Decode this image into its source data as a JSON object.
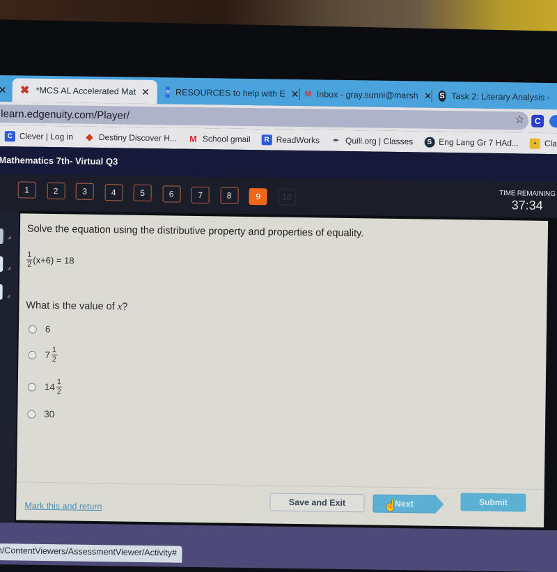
{
  "browser": {
    "tabs": [
      {
        "label": "*MCS AL Accelerated Mat",
        "icon": "edgenuity-x-icon",
        "active": true
      },
      {
        "label": "RESOURCES to help with E",
        "icon": "google-docs-icon",
        "active": false
      },
      {
        "label": "Inbox - gray.sunni@marsh",
        "icon": "gmail-icon",
        "active": false
      },
      {
        "label": "Task 2: Literary Analysis -",
        "icon": "schoology-icon",
        "active": false
      }
    ],
    "close_glyph": "✕",
    "url": "learn.edgenuity.com/Player/",
    "star_glyph": "☆",
    "bookmarks": [
      {
        "label": "Clever | Log in",
        "icon": "clever-icon"
      },
      {
        "label": "Destiny Discover H...",
        "icon": "destiny-icon"
      },
      {
        "label": "School gmail",
        "icon": "gmail-icon"
      },
      {
        "label": "ReadWorks",
        "icon": "readworks-icon"
      },
      {
        "label": "Quill.org | Classes",
        "icon": "quill-icon"
      },
      {
        "label": "Eng Lang Gr 7 HAd...",
        "icon": "schoology-icon"
      },
      {
        "label": "Class",
        "icon": "google-classroom-icon"
      }
    ],
    "status_url": "m/ContentViewers/AssessmentViewer/Activity#"
  },
  "app": {
    "course_title": "Mathematics 7th- Virtual Q3",
    "questions": [
      {
        "num": "1",
        "state": "answered"
      },
      {
        "num": "2",
        "state": "answered"
      },
      {
        "num": "3",
        "state": "answered"
      },
      {
        "num": "4",
        "state": "answered"
      },
      {
        "num": "5",
        "state": "answered"
      },
      {
        "num": "6",
        "state": "answered"
      },
      {
        "num": "7",
        "state": "answered"
      },
      {
        "num": "8",
        "state": "answered"
      },
      {
        "num": "9",
        "state": "current"
      },
      {
        "num": "10",
        "state": "disabled"
      }
    ],
    "timer": {
      "label": "TIME REMAINING",
      "value": "37:34"
    },
    "colors": {
      "current_question": "#f0671a",
      "action_button": "#5cb1d2",
      "link": "#4a8fb0"
    }
  },
  "question": {
    "prompt": "Solve the equation using the distributive property and properties of equality.",
    "equation": {
      "coef_num": "1",
      "coef_den": "2",
      "rest": "(x+6) = 18"
    },
    "ask_prefix": "What is the value of ",
    "ask_var": "x",
    "ask_suffix": "?",
    "choices": [
      {
        "whole": "6",
        "num": "",
        "den": ""
      },
      {
        "whole": "7",
        "num": "1",
        "den": "2"
      },
      {
        "whole": "14",
        "num": "1",
        "den": "2"
      },
      {
        "whole": "30",
        "num": "",
        "den": ""
      }
    ]
  },
  "footer": {
    "mark_link": "Mark this and return",
    "save_exit": "Save and Exit",
    "next": "Next",
    "submit": "Submit"
  }
}
